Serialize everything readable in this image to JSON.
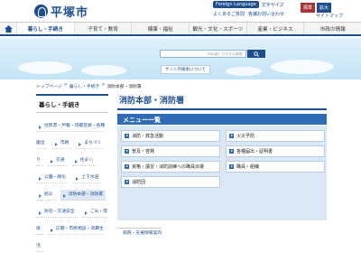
{
  "header": {
    "logo_text": "平塚市",
    "foreign_language": "Foreign Language",
    "font_size_label": "文字サイズ",
    "font_sizes": [
      "標準",
      "拡大"
    ],
    "util_links": [
      "よくあるご質問",
      "各課お問い合わせ",
      "サイトマップ"
    ],
    "links_row2": [
      "音声読み上げ",
      "ふりがな"
    ]
  },
  "nav": {
    "home_icon": "home-icon",
    "items": [
      "暮らし・手続き",
      "子育て・教育",
      "健康・福祉",
      "観光・文化・スポーツ",
      "産業・ビジネス",
      "市政の情報"
    ]
  },
  "search": {
    "placeholder": "Google カスタム検索",
    "button_icon": "search-icon",
    "foreign_link": "サイト内検索について"
  },
  "breadcrumb": [
    "トップページ",
    "暮らし・手続き",
    "消防本部・消防署"
  ],
  "sidebar": {
    "heading": "暮らし・手続き",
    "items": [
      "住民票・戸籍・印鑑登録・各種届出",
      "市税",
      "まちづくり",
      "交通",
      "住まい",
      "公園・緑化",
      "上下水道",
      "防災",
      "消防本部・消防署",
      "防犯・交通安全",
      "ごみ・環境",
      "広聴・市民相談・消費生活"
    ],
    "current_index": 8
  },
  "main": {
    "title": "消防本部・消防署",
    "menu_heading": "メニュー一覧",
    "menu": [
      "消防・救急活動",
      "火災予防",
      "普及・啓発",
      "各種届出・証明書",
      "資格・講習・消防訓練への職員派遣",
      "職員・組織",
      "消防団",
      ""
    ],
    "related": "病院・支援情報案内"
  },
  "colors": {
    "brand": "#1d4f8f",
    "menu_bar": "#2f6cb5",
    "menu_bg": "#dae8f5"
  }
}
